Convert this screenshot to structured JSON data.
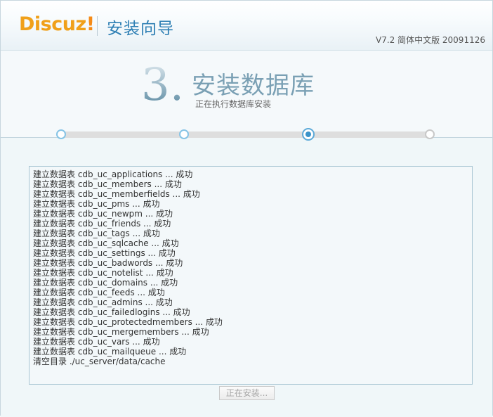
{
  "header": {
    "logo": "Discuz",
    "logo_bang": "!",
    "title": "安装向导",
    "version": "V7.2 简体中文版 20091126"
  },
  "step": {
    "number": "3.",
    "title": "安装数据库",
    "subtitle": "正在执行数据库安装"
  },
  "progress": {
    "total_steps": 4,
    "current_step": 3
  },
  "log": {
    "lines": [
      "建立数据表 cdb_uc_applications ... 成功",
      "建立数据表 cdb_uc_members ... 成功",
      "建立数据表 cdb_uc_memberfields ... 成功",
      "建立数据表 cdb_uc_pms ... 成功",
      "建立数据表 cdb_uc_newpm ... 成功",
      "建立数据表 cdb_uc_friends ... 成功",
      "建立数据表 cdb_uc_tags ... 成功",
      "建立数据表 cdb_uc_sqlcache ... 成功",
      "建立数据表 cdb_uc_settings ... 成功",
      "建立数据表 cdb_uc_badwords ... 成功",
      "建立数据表 cdb_uc_notelist ... 成功",
      "建立数据表 cdb_uc_domains ... 成功",
      "建立数据表 cdb_uc_feeds ... 成功",
      "建立数据表 cdb_uc_admins ... 成功",
      "建立数据表 cdb_uc_failedlogins ... 成功",
      "建立数据表 cdb_uc_protectedmembers ... 成功",
      "建立数据表 cdb_uc_mergemembers ... 成功",
      "建立数据表 cdb_uc_vars ... 成功",
      "建立数据表 cdb_uc_mailqueue ... 成功",
      "清空目录 ./uc_server/data/cache"
    ]
  },
  "button": {
    "label": "正在安装..."
  },
  "colors": {
    "logo": "#f0a01a",
    "title": "#2e7fb4",
    "step_dot": "#86c4e6",
    "active_dot": "#3b93c9"
  }
}
